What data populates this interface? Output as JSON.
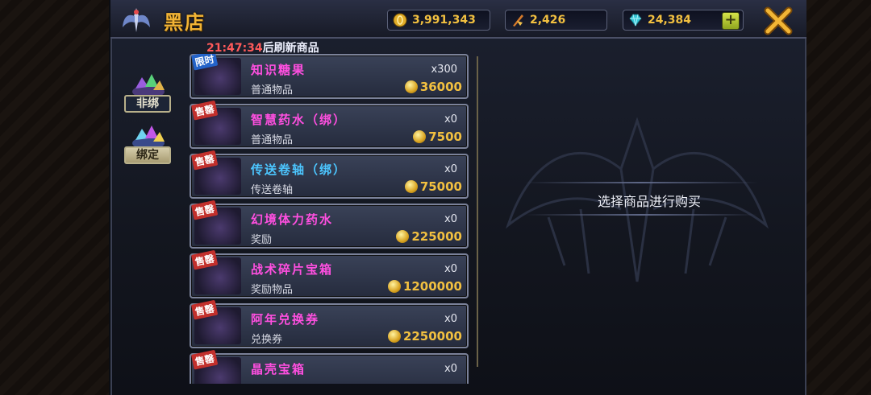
{
  "header": {
    "title": "黑店",
    "gold": "3,991,343",
    "rank_points": "2,426",
    "gems": "24,384",
    "add_label": "+"
  },
  "timer": {
    "time": "21:47:34",
    "suffix": "后刷新商品"
  },
  "tabs": [
    {
      "label": "非绑",
      "active": false
    },
    {
      "label": "绑定",
      "active": true
    }
  ],
  "items": [
    {
      "badge": "限时",
      "name": "知识糖果",
      "qty": "x300",
      "category": "普通物品",
      "price": "36000",
      "name_color": "pink"
    },
    {
      "badge": "售罄",
      "name": "智慧药水（绑）",
      "qty": "x0",
      "category": "普通物品",
      "price": "7500",
      "name_color": "pink"
    },
    {
      "badge": "售罄",
      "name": "传送卷轴（绑）",
      "qty": "x0",
      "category": "传送卷轴",
      "price": "75000",
      "name_color": "blue"
    },
    {
      "badge": "售罄",
      "name": "幻境体力药水",
      "qty": "x0",
      "category": "奖励",
      "price": "225000",
      "name_color": "pink"
    },
    {
      "badge": "售罄",
      "name": "战术碎片宝箱",
      "qty": "x0",
      "category": "奖励物品",
      "price": "1200000",
      "name_color": "pink"
    },
    {
      "badge": "售罄",
      "name": "阿年兑换券",
      "qty": "x0",
      "category": "兑换券",
      "price": "2250000",
      "name_color": "pink"
    },
    {
      "badge": "售罄",
      "name": "晶壳宝箱",
      "qty": "x0",
      "category": "",
      "price": "",
      "name_color": "pink"
    }
  ],
  "detail": {
    "prompt": "选择商品进行购买"
  }
}
